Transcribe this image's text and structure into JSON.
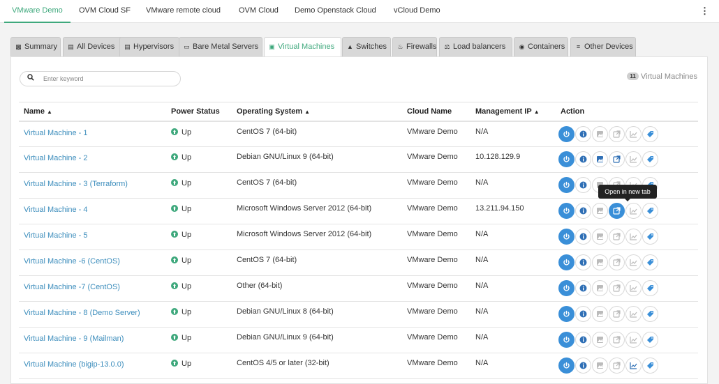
{
  "cloud_tabs": [
    {
      "label": "VMware Demo",
      "active": true
    },
    {
      "label": "OVM Cloud SF"
    },
    {
      "label": "VMware remote cloud"
    },
    {
      "label": "OVM Cloud"
    },
    {
      "label": "Demo Openstack Cloud"
    },
    {
      "label": "vCloud Demo"
    }
  ],
  "menu_icon": "⋮",
  "tabs": [
    {
      "label": "Summary",
      "icon": "summary-icon"
    },
    {
      "label": "All Devices",
      "icon": "devices-icon"
    },
    {
      "label": "Hypervisors",
      "icon": "hypervisor-icon"
    },
    {
      "label": "Bare Metal Servers",
      "icon": "laptop-icon"
    },
    {
      "label": "Virtual Machines",
      "icon": "vm-icon",
      "active": true
    },
    {
      "label": "Switches",
      "icon": "sitemap-icon"
    },
    {
      "label": "Firewalls",
      "icon": "fire-icon"
    },
    {
      "label": "Load balancers",
      "icon": "balance-icon"
    },
    {
      "label": "Containers",
      "icon": "container-icon"
    },
    {
      "label": "Other Devices",
      "icon": "sliders-icon"
    }
  ],
  "search": {
    "placeholder": "Enter keyword",
    "value": ""
  },
  "count": {
    "number": "11",
    "label": "Virtual Machines"
  },
  "columns": {
    "name": "Name",
    "power": "Power Status",
    "os": "Operating System",
    "cloud": "Cloud Name",
    "ip": "Management IP",
    "action": "Action"
  },
  "rows": [
    {
      "name": "Virtual Machine - 1",
      "power": "Up",
      "os": "CentOS 7 (64-bit)",
      "cloud": "VMware Demo",
      "ip": "N/A",
      "active_actions": [
        0,
        1,
        5
      ]
    },
    {
      "name": "Virtual Machine - 2",
      "power": "Up",
      "os": "Debian GNU/Linux 9 (64-bit)",
      "cloud": "VMware Demo",
      "ip": "10.128.129.9",
      "active_actions": [
        0,
        1,
        2,
        3,
        5
      ]
    },
    {
      "name": "Virtual Machine - 3 (Terraform)",
      "power": "Up",
      "os": "CentOS 7 (64-bit)",
      "cloud": "VMware Demo",
      "ip": "N/A",
      "active_actions": [
        0,
        1,
        5
      ]
    },
    {
      "name": "Virtual Machine - 4",
      "power": "Up",
      "os": "Microsoft Windows Server 2012 (64-bit)",
      "cloud": "VMware Demo",
      "ip": "13.211.94.150",
      "active_actions": [
        0,
        1,
        3,
        5
      ]
    },
    {
      "name": "Virtual Machine - 5",
      "power": "Up",
      "os": "Microsoft Windows Server 2012 (64-bit)",
      "cloud": "VMware Demo",
      "ip": "N/A",
      "active_actions": [
        0,
        1,
        5
      ]
    },
    {
      "name": "Virtual Machine -6 (CentOS)",
      "power": "Up",
      "os": "CentOS 7 (64-bit)",
      "cloud": "VMware Demo",
      "ip": "N/A",
      "active_actions": [
        0,
        1,
        5
      ]
    },
    {
      "name": "Virtual Machine -7 (CentOS)",
      "power": "Up",
      "os": "Other (64-bit)",
      "cloud": "VMware Demo",
      "ip": "N/A",
      "active_actions": [
        0,
        1,
        5
      ]
    },
    {
      "name": "Virtual Machine - 8 (Demo Server)",
      "power": "Up",
      "os": "Debian GNU/Linux 8 (64-bit)",
      "cloud": "VMware Demo",
      "ip": "N/A",
      "active_actions": [
        0,
        1,
        5
      ]
    },
    {
      "name": "Virtual Machine - 9 (Mailman)",
      "power": "Up",
      "os": "Debian GNU/Linux 9 (64-bit)",
      "cloud": "VMware Demo",
      "ip": "N/A",
      "active_actions": [
        0,
        1,
        5
      ]
    },
    {
      "name": "Virtual Machine (bigip-13.0.0)",
      "power": "Up",
      "os": "CentOS 4/5 or later (32-bit)",
      "cloud": "VMware Demo",
      "ip": "N/A",
      "active_actions": [
        0,
        1,
        4,
        5
      ]
    }
  ],
  "action_buttons": [
    "power-icon",
    "info-icon",
    "image-icon",
    "external-link-icon",
    "chart-icon",
    "tag-icon"
  ],
  "tooltip": "Open in new tab",
  "colors": {
    "accent": "#3ea87c",
    "link": "#3c8dbc",
    "action_blue": "#3a8fd8"
  }
}
